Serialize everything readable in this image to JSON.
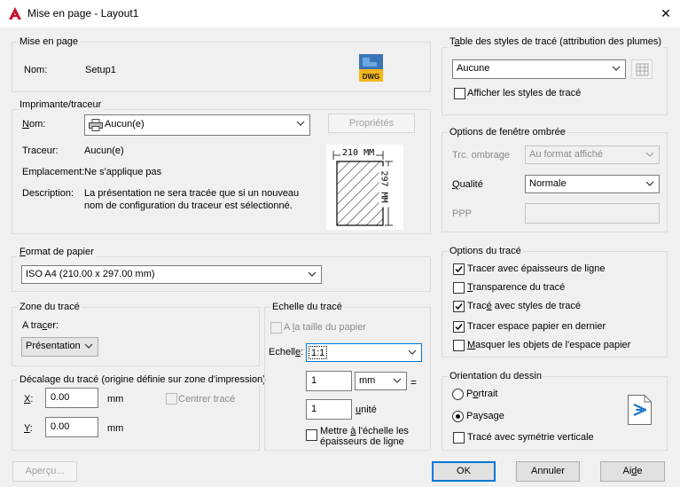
{
  "window": {
    "title": "Mise en page - Layout1",
    "close_glyph": "✕"
  },
  "page_setup": {
    "label": "Mise en page",
    "name_label": "Nom:",
    "name_value": "Setup1",
    "icon_text": "DWG"
  },
  "printer": {
    "label": "Imprimante/traceur",
    "name_label": "Nom:",
    "name_value": "Aucun(e)",
    "properties_button": "Propriétés",
    "plotter_label": "Traceur:",
    "plotter_value": "Aucun(e)",
    "location_label": "Emplacement:",
    "location_value": "Ne s'applique pas",
    "description_label": "Description:",
    "description_line1": "La présentation ne sera tracée que si un nouveau",
    "description_line2": "nom de configuration du traceur est sélectionné.",
    "preview_width": "210 MM",
    "preview_height": "297 MM"
  },
  "paper_size": {
    "label": "Format de papier",
    "value": "ISO A4 (210.00 x 297.00 mm)"
  },
  "plot_area": {
    "label": "Zone du tracé",
    "what_label": "A tracer:",
    "what_value": "Présentation"
  },
  "plot_offset": {
    "label": "Décalage du tracé (origine définie sur zone d'impression)",
    "x_label": "X:",
    "x_value": "0.00",
    "x_unit": "mm",
    "y_label": "Y:",
    "y_value": "0.00",
    "y_unit": "mm",
    "center_label": "Centrer tracé"
  },
  "plot_scale": {
    "label": "Echelle du tracé",
    "fit_label": "A la taille du papier",
    "scale_label": "Echelle:",
    "scale_value": "1:1",
    "value1": "1",
    "unit_value": "mm",
    "equals": "=",
    "value2": "1",
    "unit_label": "unité",
    "lineweights_line1": "Mettre à l'échelle les",
    "lineweights_line2": "épaisseurs de ligne"
  },
  "style_table": {
    "label": "Table des styles de tracé (attribution des plumes)",
    "value": "Aucune",
    "display_label": "Afficher les styles de tracé"
  },
  "shaded_viewport": {
    "label": "Options de fenêtre ombrée",
    "shade_label": "Trc. ombrage",
    "shade_value": "Au format affiché",
    "quality_label": "Qualité",
    "quality_value": "Normale",
    "dpi_label": "PPP"
  },
  "plot_options": {
    "label": "Options du tracé",
    "items": [
      {
        "label": "Tracer avec épaisseurs de ligne",
        "checked": true
      },
      {
        "label": "Transparence du tracé",
        "checked": false
      },
      {
        "label": "Tracé avec styles de tracé",
        "checked": true
      },
      {
        "label": "Tracer espace papier en dernier",
        "checked": true
      },
      {
        "label": "Masquer les objets de l'espace papier",
        "checked": false
      }
    ]
  },
  "orientation": {
    "label": "Orientation du dessin",
    "portrait": "Portrait",
    "landscape": "Paysage",
    "upside_down": "Tracé avec symétrie verticale",
    "selected": "Paysage"
  },
  "footer": {
    "preview": "Aperçu...",
    "ok": "OK",
    "cancel": "Annuler",
    "help": "Aide"
  },
  "colors": {
    "accent": "#0078d7",
    "autocad_red": "#c8102e",
    "group_border": "#dcdcdc"
  }
}
